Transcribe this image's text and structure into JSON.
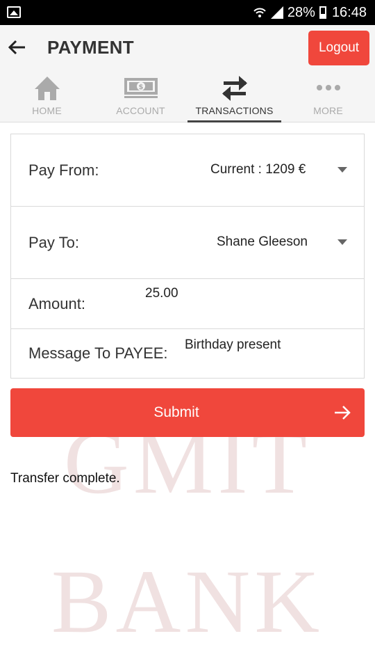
{
  "statusbar": {
    "battery": "28%",
    "time": "16:48"
  },
  "appbar": {
    "title": "PAYMENT",
    "logout_label": "Logout"
  },
  "tabs": [
    {
      "label": "HOME",
      "icon": "home-icon",
      "active": false
    },
    {
      "label": "ACCOUNT",
      "icon": "cash-icon",
      "active": false
    },
    {
      "label": "TRANSACTIONS",
      "icon": "swap-arrows-icon",
      "active": true
    },
    {
      "label": "MORE",
      "icon": "more-dots-icon",
      "active": false
    }
  ],
  "form": {
    "pay_from": {
      "label": "Pay From:",
      "value": "Current : 1209 €"
    },
    "pay_to": {
      "label": "Pay To:",
      "value": "Shane Gleeson"
    },
    "amount": {
      "label": "Amount:",
      "value": "25.00"
    },
    "message": {
      "label": "Message To PAYEE:",
      "value": "Birthday present"
    }
  },
  "submit": {
    "label": "Submit"
  },
  "result": {
    "message": "Transfer complete."
  },
  "watermark": {
    "line1": "GMIT",
    "line2": "BANK"
  },
  "colors": {
    "accent": "#f0473c",
    "tab_bar_bg": "#f5f5f5",
    "inactive_tab": "#aaaaaa"
  }
}
